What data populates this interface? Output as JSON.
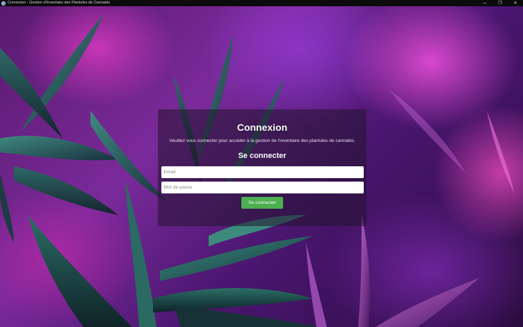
{
  "window": {
    "title": "Connexion - Gestion d'Inventaire des Plantules de Cannabis",
    "icon": "globe-icon",
    "controls": {
      "minimize": "—",
      "maximize": "❐",
      "close": "✕"
    }
  },
  "login": {
    "heading": "Connexion",
    "subtitle": "Veuillez vous connecter pour accéder à la gestion de l'inventaire des plantules de cannabis.",
    "section_title": "Se connecter",
    "email": {
      "placeholder": "Email",
      "value": ""
    },
    "password": {
      "placeholder": "Mot de passe",
      "value": ""
    },
    "submit_label": "Se connecter"
  },
  "colors": {
    "accent_button": "#4caf50",
    "card_overlay": "rgba(35,20,45,0.55)",
    "background_magenta": "#e040c8",
    "leaf_teal": "#2f7a6e"
  }
}
